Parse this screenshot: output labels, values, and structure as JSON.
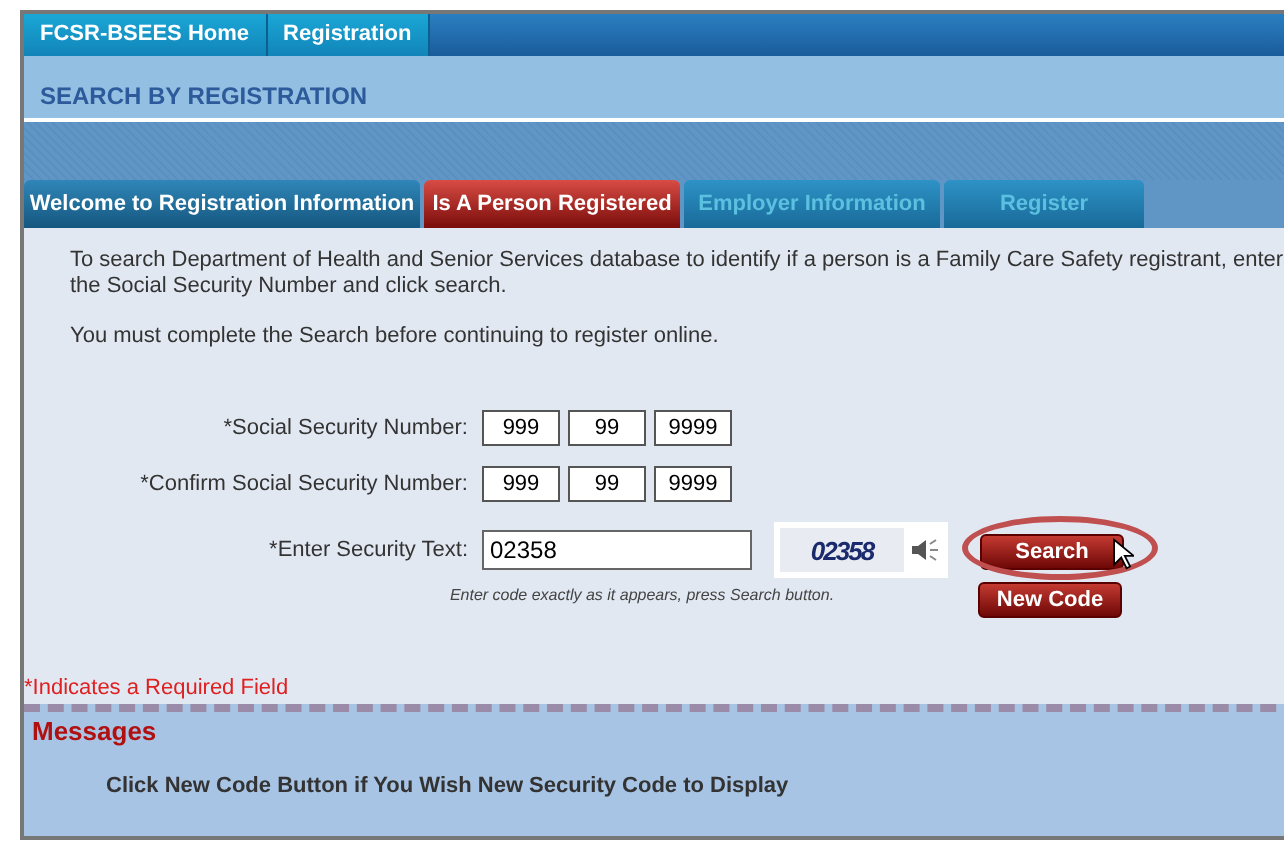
{
  "top_nav": [
    "FCSR-BSEES Home",
    "Registration"
  ],
  "page_title": "SEARCH BY REGISTRATION",
  "tabs": [
    {
      "label": "Welcome to Registration Information",
      "selected": false,
      "disabled": false
    },
    {
      "label": "Is A Person Registered",
      "selected": true,
      "disabled": false
    },
    {
      "label": "Employer Information",
      "selected": false,
      "disabled": true
    },
    {
      "label": "Register",
      "selected": false,
      "disabled": true
    }
  ],
  "intro": "To search Department of Health and Senior Services database to identify if a person is a Family Care Safety registrant, enter the Social Security Number and click search.",
  "notice": "You must complete the Search before continuing to register online.",
  "ssn": {
    "label": "*Social Security Number:",
    "parts": [
      "999",
      "99",
      "9999"
    ]
  },
  "confirm_ssn": {
    "label": "*Confirm Social Security Number:",
    "parts": [
      "999",
      "99",
      "9999"
    ]
  },
  "security": {
    "label": "*Enter Security Text:",
    "value": "02358",
    "captcha_text": "02358",
    "hint": "Enter code exactly as it appears, press Search button."
  },
  "buttons": {
    "search": "Search",
    "new_code": "New Code"
  },
  "required_note": "*Indicates a Required Field",
  "messages": {
    "title": "Messages",
    "text": "Click New Code Button if You Wish New Security Code to Display"
  }
}
